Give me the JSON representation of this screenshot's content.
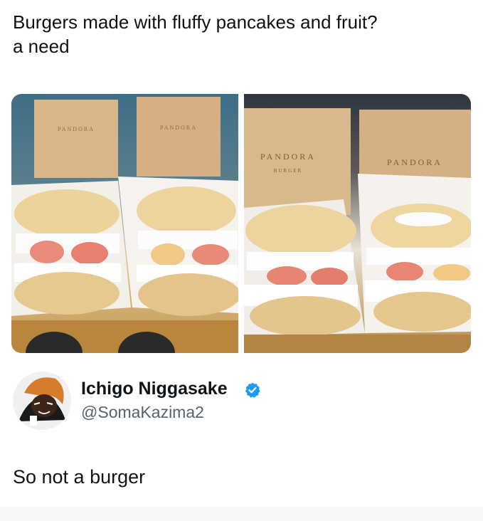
{
  "post": {
    "text_line1": "Burgers made with fluffy pancakes and fruit?",
    "text_line2": "a need"
  },
  "media": {
    "left_box_brand": "PANDORA",
    "left_box_sub": "BURGER",
    "right_box_brand": "PANDORA",
    "right_box_sub": "BURGER"
  },
  "reply": {
    "author": {
      "display_name": "Ichigo Niggasake",
      "handle": "@SomaKazima2",
      "verified_icon": "verified-badge-icon",
      "verified_color": "#1d9bf0"
    },
    "text": "So not a burger"
  }
}
